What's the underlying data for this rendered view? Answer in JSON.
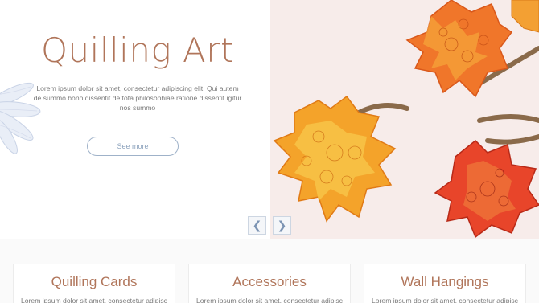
{
  "hero": {
    "title": "Quilling Art",
    "description": "Lorem ipsum dolor sit amet, consectetur adipiscing elit. Qui autem de summo bono dissentit de tota philosophiae ratione dissentit  igitur nos summo",
    "cta_label": "See more",
    "prev_label": "❮",
    "next_label": "❯"
  },
  "colors": {
    "title": "#b0755a",
    "button_border": "#9fb2c9",
    "image_background": "#f7ecea"
  },
  "cards": [
    {
      "title": "Quilling Cards",
      "text": "Lorem ipsum dolor sit amet, consectetur adipisc"
    },
    {
      "title": "Accessories",
      "text": "Lorem ipsum dolor sit amet, consectetur adipisc"
    },
    {
      "title": "Wall Hangings",
      "text": "Lorem ipsum dolor sit amet, consectetur adipisc"
    }
  ]
}
